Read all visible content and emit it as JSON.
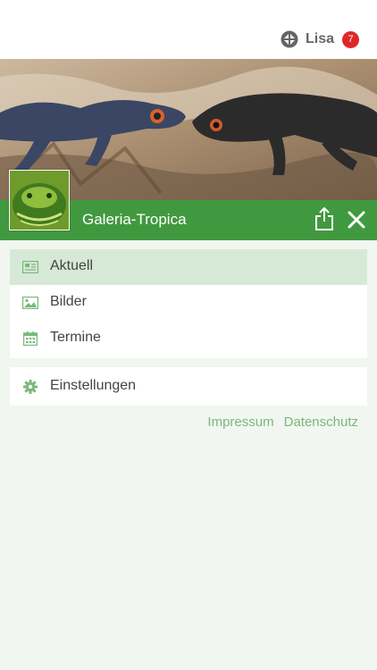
{
  "header": {
    "user_name": "Lisa",
    "badge_count": "7"
  },
  "shop": {
    "name": "Galeria-Tropica"
  },
  "menu": {
    "items": [
      {
        "label": "Aktuell",
        "icon": "newspaper-icon",
        "active": true
      },
      {
        "label": "Bilder",
        "icon": "image-icon",
        "active": false
      },
      {
        "label": "Termine",
        "icon": "calendar-icon",
        "active": false
      }
    ],
    "settings": {
      "label": "Einstellungen",
      "icon": "gear-icon"
    }
  },
  "footer": {
    "impressum": "Impressum",
    "datenschutz": "Datenschutz"
  },
  "colors": {
    "brand_green": "#41993f",
    "active_bg": "#d6e9d6",
    "link_green": "#7ab87a",
    "page_bg": "#f1f6f0",
    "badge_red": "#e02727"
  }
}
